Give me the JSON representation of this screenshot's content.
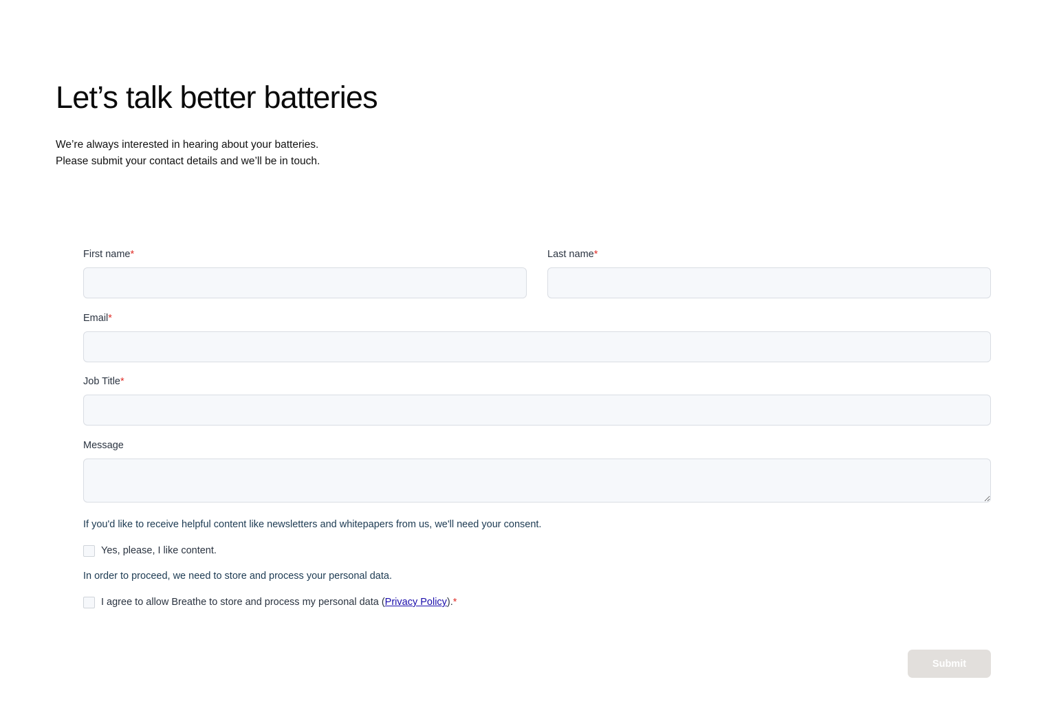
{
  "heading": "Let’s talk better batteries",
  "intro": {
    "line1": "We’re always interested in hearing about your batteries.",
    "line2": "Please submit your contact details and we’ll be in touch."
  },
  "form": {
    "required_marker": "*",
    "first_name": {
      "label": "First name",
      "value": ""
    },
    "last_name": {
      "label": "Last name",
      "value": ""
    },
    "email": {
      "label": "Email",
      "value": ""
    },
    "job_title": {
      "label": "Job Title",
      "value": ""
    },
    "message": {
      "label": "Message",
      "value": ""
    }
  },
  "consent": {
    "marketing_text": "If you'd like to receive helpful content like newsletters and whitepapers from us, we'll need your consent.",
    "marketing_checkbox_label": "Yes, please, I like content.",
    "processing_text": "In order to proceed, we need to store and process your personal data.",
    "processing_checkbox_prefix": "I agree to allow Breathe to store and process my personal data (",
    "privacy_link_text": "Privacy Policy",
    "processing_checkbox_suffix": ")."
  },
  "submit_label": "Submit",
  "colors": {
    "required": "#e0302a",
    "field_background": "#f6f8fb",
    "submit_background": "#e2dfdc",
    "link": "#1a0dab"
  }
}
